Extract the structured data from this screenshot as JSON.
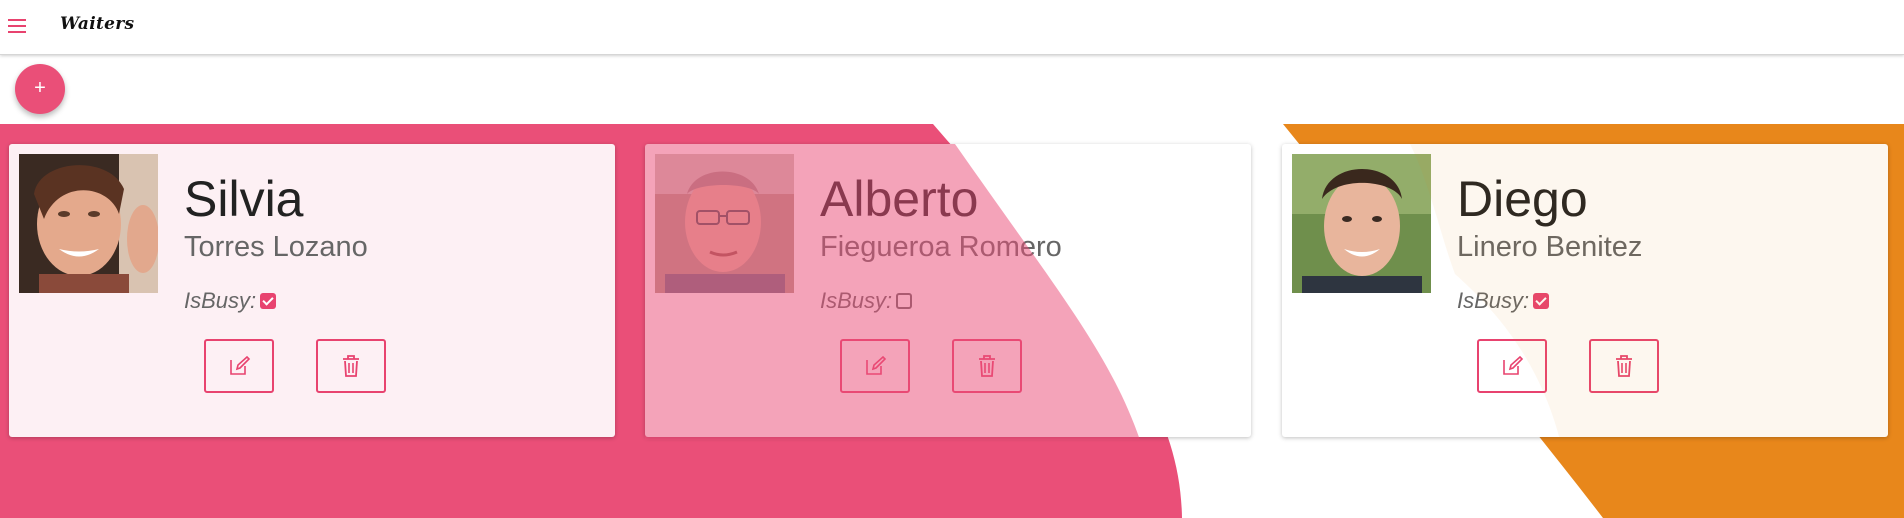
{
  "app": {
    "title": "Waiters"
  },
  "colors": {
    "accent": "#ea4f78",
    "orange": "#e8871b",
    "pink_bg": "#ea4f78"
  },
  "icons": {
    "menu": "hamburger-menu-icon",
    "add": "plus-icon",
    "edit": "edit-icon",
    "delete": "trash-icon"
  },
  "fab": {
    "label": "+"
  },
  "waiters": [
    {
      "first_name": "Silvia",
      "last_name": "Torres Lozano",
      "busy_label": "IsBusy:",
      "is_busy": true
    },
    {
      "first_name": "Alberto",
      "last_name": "Fiegueroa Romero",
      "busy_label": "IsBusy:",
      "is_busy": false
    },
    {
      "first_name": "Diego",
      "last_name": "Linero Benitez",
      "busy_label": "IsBusy:",
      "is_busy": true
    }
  ]
}
